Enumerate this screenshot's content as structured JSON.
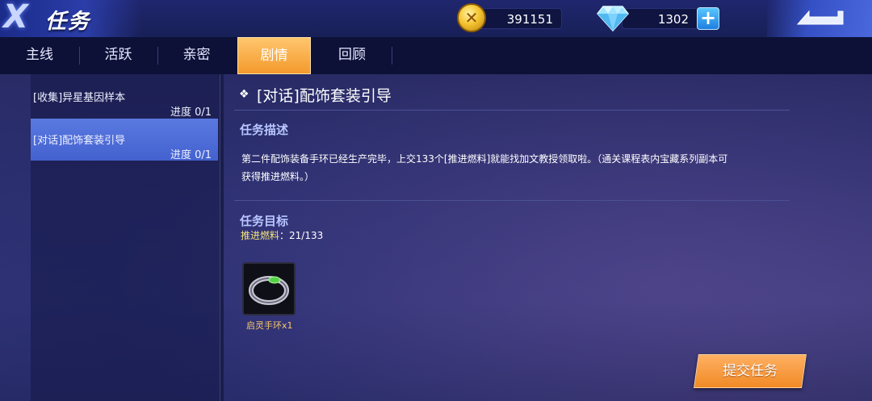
{
  "header": {
    "logo_glyph": "X",
    "title": "任务",
    "gold": {
      "icon": "gold-coin-icon",
      "amount": "391151"
    },
    "diamond": {
      "icon": "diamond-icon",
      "amount": "1302"
    },
    "add_icon": "plus-icon",
    "back_icon": "return-arrow-icon"
  },
  "tabs": [
    {
      "label": "主线",
      "active": false
    },
    {
      "label": "活跃",
      "active": false
    },
    {
      "label": "亲密",
      "active": false
    },
    {
      "label": "剧情",
      "active": true
    },
    {
      "label": "回顾",
      "active": false
    }
  ],
  "quests": [
    {
      "name": "[收集]异星基因样本",
      "progress": "进度 0/1",
      "selected": false
    },
    {
      "name": "[对话]配饰套装引导",
      "progress": "进度 0/1",
      "selected": true
    }
  ],
  "detail": {
    "title": "[对话]配饰套装引导",
    "desc_heading": "任务描述",
    "description_line1": "第二件配饰装备手环已经生产完毕，上交133个[推进燃料]就能找加文教授领取啦。（通关课程表内宝藏系列副本可",
    "description_line2": "获得推进燃料。）",
    "goal_heading": "任务目标",
    "objective_name": "推进燃料",
    "objective_count": "：21/133",
    "reward": {
      "icon": "bracelet-icon",
      "label": "启灵手环x1"
    },
    "submit_label": "提交任务"
  },
  "colors": {
    "accent_orange": "#f39a2d",
    "selected_blue": "#4a68d6",
    "objective_yellow": "#f2e57a",
    "reward_label": "#f7c86a"
  }
}
